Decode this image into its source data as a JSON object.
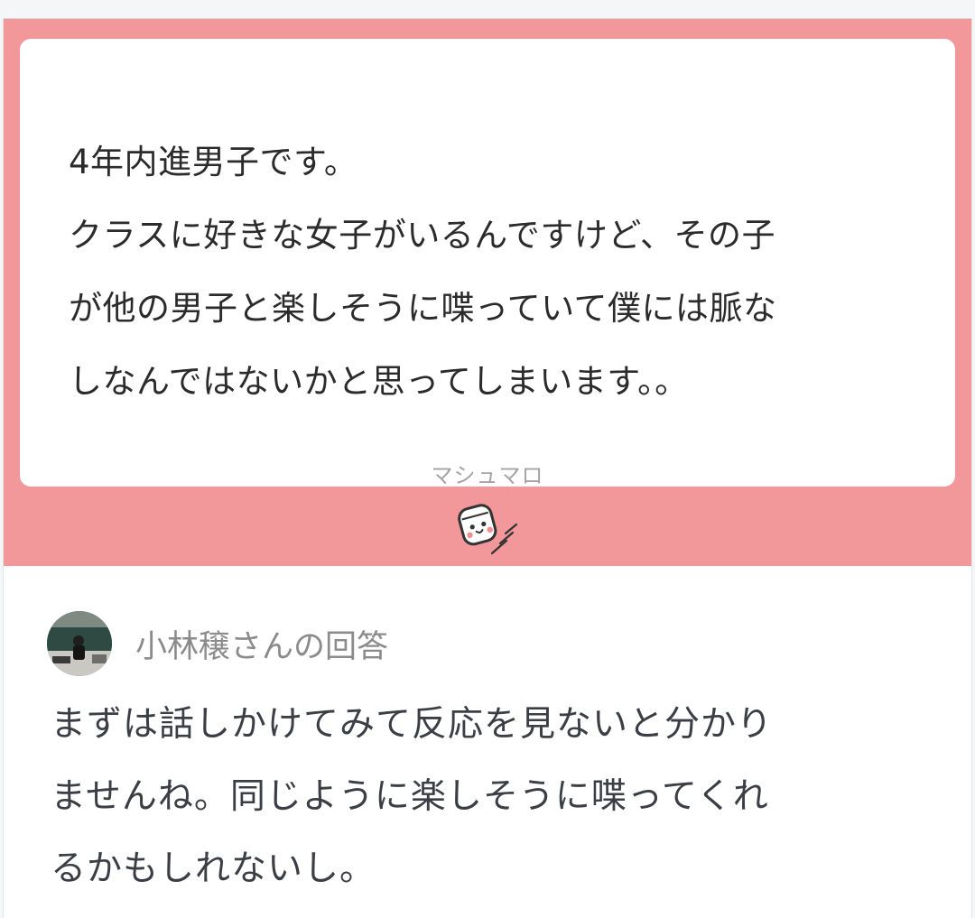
{
  "question": {
    "lines": [
      "4年内進男子です。",
      "クラスに好きな女子がいるんですけど、その子",
      "が他の男子と楽しそうに喋っていて僕には脈な",
      "しなんではないかと思ってしまいます。。"
    ],
    "brand_label": "マシュマロ"
  },
  "mascot": {
    "icon": "marshmallow-mascot-icon"
  },
  "answer": {
    "avatar_icon": "user-avatar",
    "header": "小林穣さんの回答",
    "lines": [
      "まずは話しかけてみて反応を見ないと分かり",
      "ませんね。同じように楽しそうに喋ってくれ",
      "るかもしれないし。"
    ]
  },
  "colors": {
    "panel": "#f2979a",
    "page_background": "#f5f6f8",
    "question_text": "#2b2b2b",
    "answer_text": "#3b3f45",
    "muted": "#8b8b8b"
  }
}
